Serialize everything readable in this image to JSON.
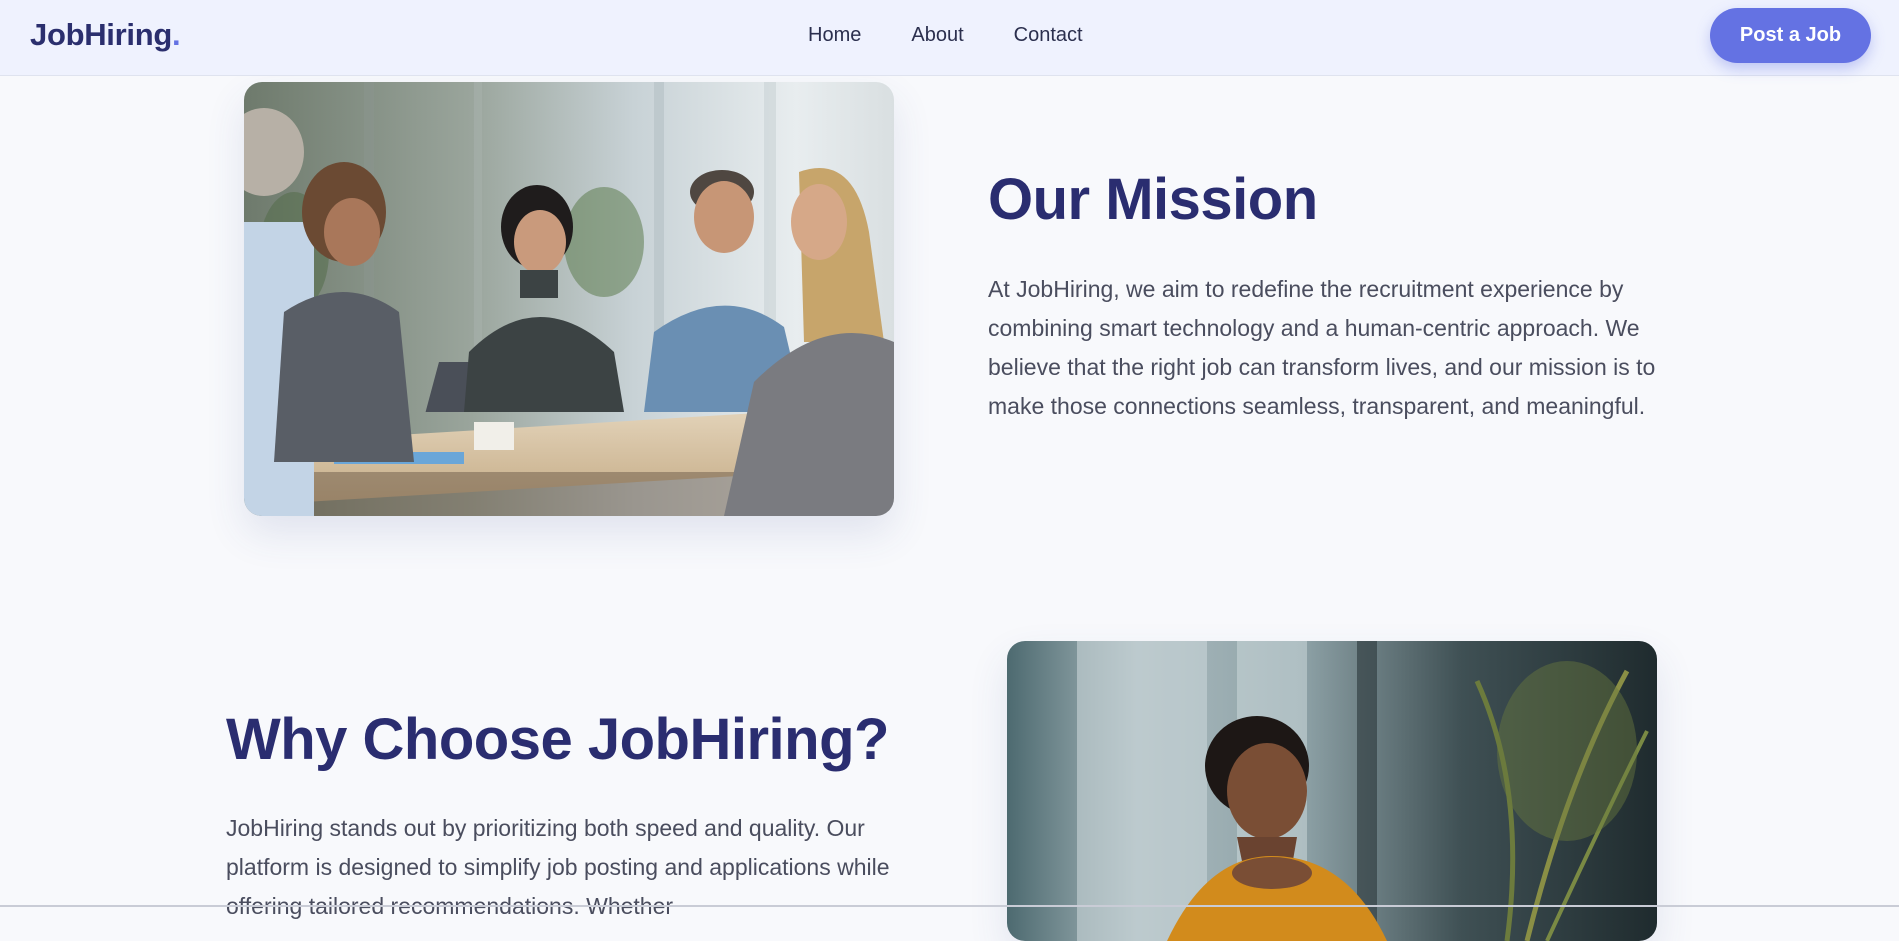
{
  "brand": {
    "name": "JobHiring",
    "dot": ".",
    "accent": "#6472e3",
    "text_color": "#2b2f6e"
  },
  "nav": {
    "links": [
      {
        "label": "Home"
      },
      {
        "label": "About"
      },
      {
        "label": "Contact"
      }
    ],
    "cta_label": "Post a Job"
  },
  "mission": {
    "heading": "Our Mission",
    "paragraph": "At JobHiring, we aim to redefine the recruitment experience by combining smart technology and a human-centric approach. We believe that the right job can transform lives, and our mission is to make those connections seamless, transparent, and meaningful."
  },
  "why": {
    "heading": "Why Choose JobHiring?",
    "paragraph": "JobHiring stands out by prioritizing both speed and quality. Our platform is designed to simplify job posting and applications while offering tailored recommendations. Whether"
  },
  "colors": {
    "navbar_bg": "#eff2fe",
    "page_bg": "#f8f9fc",
    "heading": "#2a2d70",
    "body_text": "#4a4d5e"
  }
}
